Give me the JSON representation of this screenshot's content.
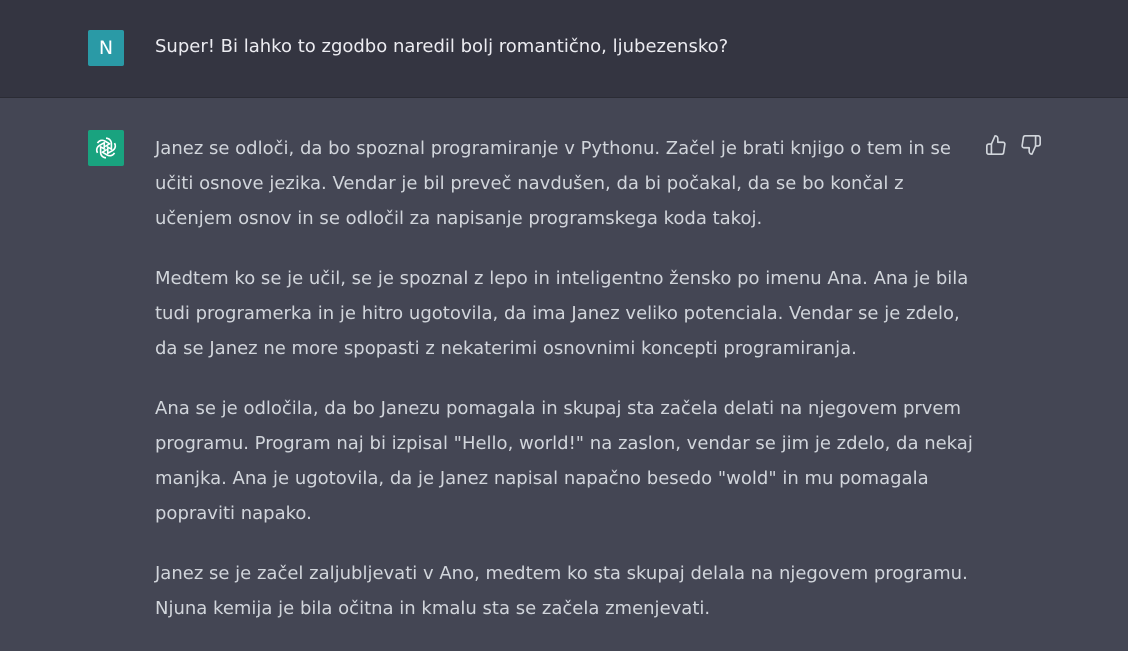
{
  "user_message": {
    "avatar_letter": "N",
    "text": "Super! Bi lahko to zgodbo naredil bolj romantično, ljubezensko?"
  },
  "assistant_message": {
    "avatar_icon": "openai-logo-icon",
    "paragraphs": [
      "Janez se odloči, da bo spoznal programiranje v Pythonu. Začel je brati knjigo o tem in se učiti osnove jezika. Vendar je bil preveč navdušen, da bi počakal, da se bo končal z učenjem osnov in se odločil za napisanje programskega koda takoj.",
      "Medtem ko se je učil, se je spoznal z lepo in inteligentno žensko po imenu Ana. Ana je bila tudi programerka in je hitro ugotovila, da ima Janez veliko potenciala. Vendar se je zdelo, da se Janez ne more spopasti z nekaterimi osnovnimi koncepti programiranja.",
      "Ana se je odločila, da bo Janezu pomagala in skupaj sta začela delati na njegovem prvem programu. Program naj bi izpisal \"Hello, world!\" na zaslon, vendar se jim je zdelo, da nekaj manjka. Ana je ugotovila, da je Janez napisal napačno besedo \"wold\" in mu pomagala popraviti napako.",
      "Janez se je začel zaljubljevati v Ano, medtem ko sta skupaj delala na njegovem programu. Njuna kemija je bila očitna in kmalu sta se začela zmenjevati."
    ],
    "feedback_icons": [
      "thumbs-up-icon",
      "thumbs-down-icon"
    ]
  },
  "colors": {
    "user_bg": "#343541",
    "assistant_bg": "#444654",
    "user_avatar": "#2a9aa6",
    "bot_avatar": "#19a37f",
    "text": "#d1d5db"
  }
}
